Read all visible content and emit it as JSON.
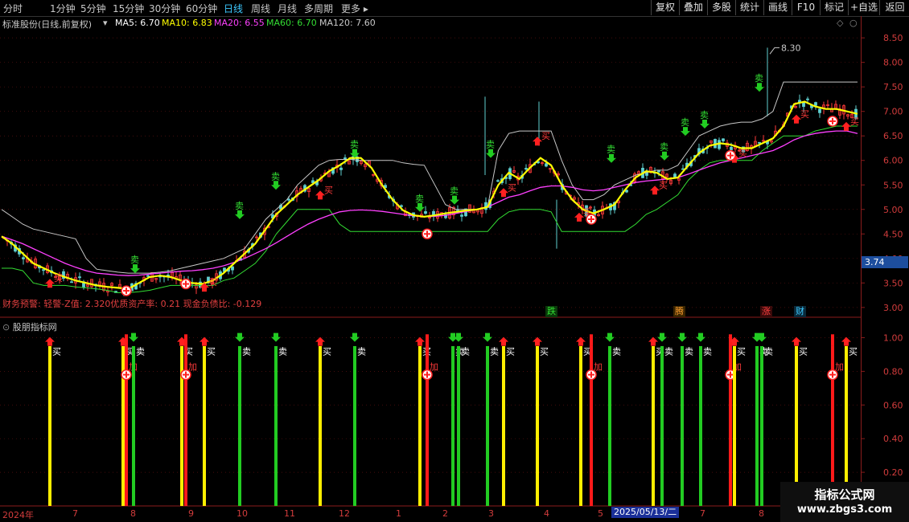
{
  "periods": [
    "分时",
    "1分钟",
    "5分钟",
    "15分钟",
    "30分钟",
    "60分钟",
    "日线",
    "周线",
    "月线",
    "多周期",
    "更多 ▸"
  ],
  "active_period": "日线",
  "right_buttons": [
    "复权",
    "叠加",
    "多股",
    "统计",
    "画线",
    "F10",
    "标记",
    "+自选",
    "返回"
  ],
  "stock_title": "标准股份(日线,前复权)",
  "ma_legend": [
    {
      "label": "MA5: 6.70",
      "color": "#ffffff"
    },
    {
      "label": "MA10: 6.83",
      "color": "#ffff00"
    },
    {
      "label": "MA20: 6.55",
      "color": "#ff40ff"
    },
    {
      "label": "MA60: 6.70",
      "color": "#33dd33"
    },
    {
      "label": "MA120: 7.60",
      "color": "#c8c8c8"
    }
  ],
  "finance_line": {
    "warn": "财务预警: 轻警-Z值: 2.320",
    "quality": "优质资产率: 0.21",
    "cash": "现金负债比: -0.129"
  },
  "event_tags": [
    {
      "text": "跌",
      "color": "#33dd33",
      "bg": "#0a3a0a"
    },
    {
      "text": "腾",
      "color": "#ffa030",
      "bg": "#3a2500"
    },
    {
      "text": "涨",
      "color": "#ff4040",
      "bg": "#3a0a0a"
    },
    {
      "text": "财",
      "color": "#3cc8ff",
      "bg": "#0a2a3a"
    }
  ],
  "sub_title": "股朋指标网",
  "current_price_label": "3.74",
  "high_mark": "8.30",
  "icons": {
    "circle": "circle-icon",
    "diamond": "diamond-icon"
  },
  "signal_labels": {
    "buy": "买",
    "sell": "卖",
    "add": "加"
  },
  "x_labels": [
    "2024年",
    "7",
    "8",
    "9",
    "10",
    "11",
    "12",
    "1",
    "2",
    "3",
    "4",
    "5",
    "7",
    "8"
  ],
  "x_highlight": "2025/05/13/二",
  "watermark": {
    "title": "指标公式网",
    "url": "www.zbgs3.com"
  },
  "chart_data": {
    "type": "line",
    "title": "",
    "xlabel": "",
    "ylabel": "",
    "price_ticks": [
      8.5,
      8.0,
      7.5,
      7.0,
      6.5,
      6.0,
      5.5,
      5.0,
      4.5,
      4.0,
      3.5,
      3.0
    ],
    "ylim": [
      2.85,
      8.65
    ],
    "sub_ticks": [
      1.0,
      0.8,
      0.6,
      0.4,
      0.2
    ],
    "sub_ylim": [
      0,
      1.05
    ],
    "high_value": 8.3,
    "ma10": [
      4.45,
      4.3,
      4.1,
      3.9,
      3.8,
      3.7,
      3.62,
      3.55,
      3.5,
      3.45,
      3.42,
      3.4,
      3.38,
      3.5,
      3.62,
      3.65,
      3.62,
      3.55,
      3.5,
      3.48,
      3.55,
      3.7,
      3.9,
      4.1,
      4.3,
      4.6,
      4.9,
      5.1,
      5.3,
      5.45,
      5.6,
      5.78,
      5.9,
      6.05,
      6.05,
      5.85,
      5.5,
      5.2,
      4.98,
      4.88,
      4.85,
      4.88,
      4.92,
      4.95,
      4.98,
      5.0,
      5.05,
      5.5,
      5.75,
      5.62,
      5.85,
      6.05,
      5.9,
      5.5,
      5.2,
      5.0,
      4.92,
      5.0,
      5.1,
      5.4,
      5.65,
      5.78,
      5.75,
      5.62,
      5.65,
      5.9,
      6.15,
      6.3,
      6.35,
      6.32,
      6.25,
      6.25,
      6.35,
      6.45,
      6.7,
      7.15,
      7.2,
      7.1,
      7.05,
      7.05,
      7.0,
      6.95
    ],
    "ma20": [
      4.45,
      4.38,
      4.3,
      4.2,
      4.1,
      4.0,
      3.9,
      3.82,
      3.75,
      3.7,
      3.68,
      3.66,
      3.65,
      3.66,
      3.68,
      3.7,
      3.72,
      3.74,
      3.75,
      3.77,
      3.8,
      3.85,
      3.92,
      4.0,
      4.1,
      4.2,
      4.32,
      4.45,
      4.58,
      4.7,
      4.8,
      4.88,
      4.95,
      4.98,
      4.99,
      4.98,
      4.96,
      4.93,
      4.9,
      4.87,
      4.85,
      4.86,
      4.88,
      4.92,
      4.96,
      5.0,
      5.05,
      5.15,
      5.25,
      5.3,
      5.38,
      5.45,
      5.48,
      5.48,
      5.45,
      5.4,
      5.38,
      5.4,
      5.45,
      5.5,
      5.55,
      5.58,
      5.6,
      5.62,
      5.65,
      5.72,
      5.8,
      5.88,
      5.95,
      6.0,
      6.05,
      6.1,
      6.15,
      6.2,
      6.3,
      6.42,
      6.5,
      6.55,
      6.58,
      6.6,
      6.6,
      6.55
    ],
    "ma60": [
      3.8,
      3.8,
      3.75,
      3.5,
      3.45,
      3.45,
      3.45,
      3.42,
      3.4,
      3.38,
      3.35,
      3.3,
      3.3,
      3.32,
      3.35,
      3.4,
      3.45,
      3.45,
      3.45,
      3.45,
      3.45,
      3.55,
      3.6,
      3.75,
      3.9,
      4.15,
      4.5,
      4.75,
      5.0,
      5.0,
      5.0,
      5.0,
      4.7,
      4.55,
      4.55,
      4.55,
      4.55,
      4.55,
      4.55,
      4.55,
      4.55,
      4.55,
      4.55,
      4.55,
      4.55,
      4.55,
      4.55,
      4.8,
      4.95,
      5.0,
      5.0,
      5.0,
      4.95,
      4.55,
      4.55,
      4.55,
      4.55,
      4.55,
      4.55,
      4.55,
      4.7,
      4.9,
      5.0,
      5.15,
      5.3,
      5.6,
      5.8,
      5.95,
      6.0,
      6.0,
      6.0,
      6.0,
      6.2,
      6.35,
      6.5,
      6.5,
      6.5,
      6.6,
      6.65,
      6.7,
      6.7,
      6.7
    ],
    "ma120": [
      5.0,
      4.85,
      4.7,
      4.6,
      4.55,
      4.5,
      4.45,
      4.4,
      4.0,
      3.78,
      3.75,
      3.72,
      3.7,
      3.7,
      3.7,
      3.72,
      3.75,
      3.8,
      3.85,
      3.9,
      3.95,
      4.0,
      4.1,
      4.2,
      4.5,
      4.8,
      5.0,
      5.2,
      5.5,
      5.7,
      5.9,
      6.0,
      6.02,
      6.02,
      6.0,
      6.0,
      6.0,
      6.0,
      5.95,
      5.92,
      5.9,
      5.5,
      5.1,
      5.0,
      5.0,
      5.0,
      5.05,
      6.2,
      6.55,
      6.6,
      6.6,
      6.6,
      6.6,
      6.0,
      5.5,
      5.2,
      5.2,
      5.3,
      5.5,
      5.6,
      5.7,
      5.75,
      5.8,
      5.8,
      5.9,
      6.2,
      6.5,
      6.6,
      6.7,
      6.75,
      6.78,
      6.78,
      6.85,
      7.0,
      7.6,
      7.6,
      7.6,
      7.6,
      7.6,
      7.6,
      7.6,
      7.6
    ],
    "buy_marks": [
      [
        62,
        3.6
      ],
      [
        254,
        3.52
      ],
      [
        398,
        5.4
      ],
      [
        626,
        5.45
      ],
      [
        668,
        6.5
      ],
      [
        720,
        4.95
      ],
      [
        814,
        5.5
      ],
      [
        913,
        6.15
      ],
      [
        990,
        6.95
      ],
      [
        1052,
        6.8
      ]
    ],
    "sell_marks": [
      [
        168,
        3.75
      ],
      [
        298,
        4.85
      ],
      [
        343,
        5.45
      ],
      [
        441,
        6.1
      ],
      [
        522,
        5.0
      ],
      [
        565,
        5.15
      ],
      [
        610,
        6.1
      ],
      [
        760,
        6.0
      ],
      [
        826,
        6.05
      ],
      [
        852,
        6.55
      ],
      [
        876,
        6.7
      ],
      [
        944,
        7.45
      ]
    ],
    "add_marks": [
      [
        157,
        3.34
      ],
      [
        231,
        3.48
      ],
      [
        531,
        4.5
      ],
      [
        735,
        4.8
      ],
      [
        908,
        6.1
      ],
      [
        1035,
        6.8
      ]
    ],
    "sub_bars": [
      {
        "x": 62,
        "color": "yellow",
        "sig": "buy"
      },
      {
        "x": 153,
        "color": "yellow",
        "sig": "buy"
      },
      {
        "x": 157,
        "color": "red",
        "sig": "add"
      },
      {
        "x": 166,
        "color": "green",
        "sig": "sell"
      },
      {
        "x": 226,
        "color": "yellow",
        "sig": "buy"
      },
      {
        "x": 231,
        "color": "red",
        "sig": "add"
      },
      {
        "x": 254,
        "color": "yellow",
        "sig": "buy"
      },
      {
        "x": 298,
        "color": "green",
        "sig": "sell"
      },
      {
        "x": 343,
        "color": "green",
        "sig": "sell"
      },
      {
        "x": 398,
        "color": "yellow",
        "sig": "buy"
      },
      {
        "x": 441,
        "color": "green",
        "sig": "sell"
      },
      {
        "x": 522,
        "color": "yellow",
        "sig": "buy"
      },
      {
        "x": 531,
        "color": "red",
        "sig": "add"
      },
      {
        "x": 563,
        "color": "green",
        "sig": "sell"
      },
      {
        "x": 570,
        "color": "green",
        "sig": "sell"
      },
      {
        "x": 606,
        "color": "green",
        "sig": "sell"
      },
      {
        "x": 626,
        "color": "yellow",
        "sig": "buy"
      },
      {
        "x": 668,
        "color": "yellow",
        "sig": "buy"
      },
      {
        "x": 722,
        "color": "yellow",
        "sig": "buy"
      },
      {
        "x": 735,
        "color": "red",
        "sig": "add"
      },
      {
        "x": 758,
        "color": "green",
        "sig": "sell"
      },
      {
        "x": 812,
        "color": "yellow",
        "sig": "buy"
      },
      {
        "x": 823,
        "color": "green",
        "sig": "sell"
      },
      {
        "x": 848,
        "color": "green",
        "sig": "sell"
      },
      {
        "x": 871,
        "color": "green",
        "sig": "sell"
      },
      {
        "x": 908,
        "color": "red",
        "sig": "add"
      },
      {
        "x": 913,
        "color": "yellow",
        "sig": "buy"
      },
      {
        "x": 941,
        "color": "green",
        "sig": "sell"
      },
      {
        "x": 947,
        "color": "green",
        "sig": "sell"
      },
      {
        "x": 990,
        "color": "yellow",
        "sig": "buy"
      },
      {
        "x": 1035,
        "color": "red",
        "sig": "add"
      },
      {
        "x": 1052,
        "color": "yellow",
        "sig": "buy"
      }
    ]
  }
}
